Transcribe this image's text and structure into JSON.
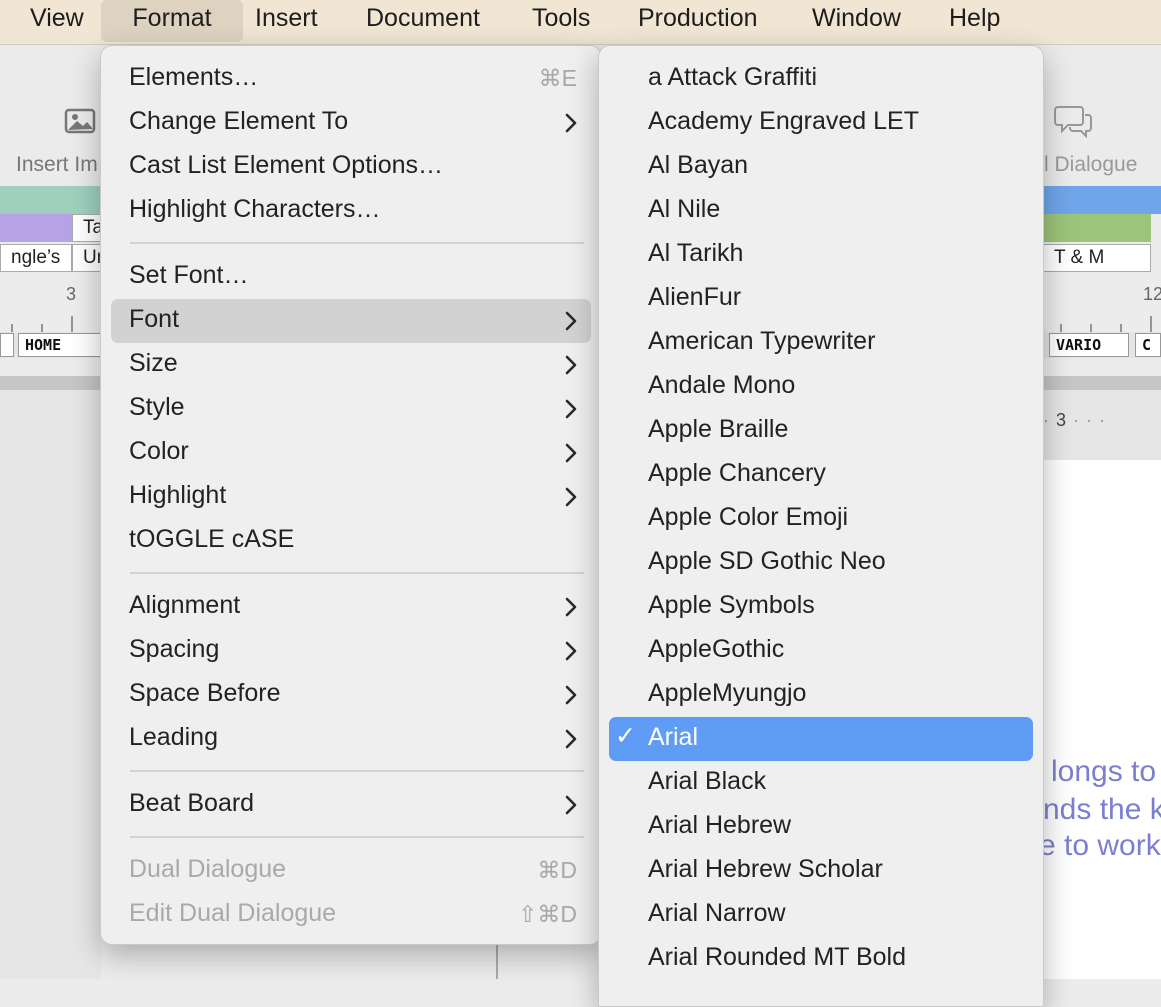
{
  "menubar": {
    "items": [
      {
        "label": "View"
      },
      {
        "label": "Format"
      },
      {
        "label": "Insert"
      },
      {
        "label": "Document"
      },
      {
        "label": "Tools"
      },
      {
        "label": "Production"
      },
      {
        "label": "Window"
      },
      {
        "label": "Help"
      }
    ]
  },
  "toolbar": {
    "insert_image_label": "Insert Im",
    "dual_dialogue_label": "l Dialogue"
  },
  "cards": {
    "left_tab": "Ta",
    "left_row_a": "ngle’s",
    "left_row_b": "Ur",
    "right_row": "T & M"
  },
  "ruler": {
    "left_number": "3",
    "right_number": "12",
    "doc_ruler_number": "3"
  },
  "scenes": {
    "home": "HOME",
    "vario": "VARIO",
    "c": "C"
  },
  "page_text": {
    "line1": "longs to",
    "line2": "nds the k",
    "line3": "e to work"
  },
  "format_menu": {
    "groups": [
      [
        {
          "label": "Elements…",
          "shortcut": "⌘E"
        },
        {
          "label": "Change Element To",
          "submenu": true
        },
        {
          "label": "Cast List Element Options…"
        },
        {
          "label": "Highlight Characters…"
        }
      ],
      [
        {
          "label": "Set Font…"
        },
        {
          "label": "Font",
          "submenu": true,
          "highlighted": true
        },
        {
          "label": "Size",
          "submenu": true
        },
        {
          "label": "Style",
          "submenu": true
        },
        {
          "label": "Color",
          "submenu": true
        },
        {
          "label": "Highlight",
          "submenu": true
        },
        {
          "label": "tOGGLE cASE"
        }
      ],
      [
        {
          "label": "Alignment",
          "submenu": true
        },
        {
          "label": "Spacing",
          "submenu": true
        },
        {
          "label": "Space Before",
          "submenu": true
        },
        {
          "label": "Leading",
          "submenu": true
        }
      ],
      [
        {
          "label": "Beat Board",
          "submenu": true
        }
      ],
      [
        {
          "label": "Dual Dialogue",
          "shortcut": "⌘D",
          "disabled": true
        },
        {
          "label": "Edit Dual Dialogue",
          "shortcut": "⇧⌘D",
          "disabled": true
        }
      ]
    ]
  },
  "font_menu": {
    "check_mark": "✓",
    "items": [
      {
        "label": "a Attack Graffiti"
      },
      {
        "label": "Academy Engraved LET"
      },
      {
        "label": "Al Bayan"
      },
      {
        "label": "Al Nile"
      },
      {
        "label": "Al Tarikh"
      },
      {
        "label": "AlienFur"
      },
      {
        "label": "American Typewriter"
      },
      {
        "label": "Andale Mono"
      },
      {
        "label": "Apple Braille"
      },
      {
        "label": "Apple Chancery"
      },
      {
        "label": "Apple Color Emoji"
      },
      {
        "label": "Apple SD Gothic Neo"
      },
      {
        "label": "Apple Symbols"
      },
      {
        "label": "AppleGothic"
      },
      {
        "label": "AppleMyungjo"
      },
      {
        "label": "Arial",
        "selected": true
      },
      {
        "label": "Arial Black"
      },
      {
        "label": "Arial Hebrew"
      },
      {
        "label": "Arial Hebrew Scholar"
      },
      {
        "label": "Arial Narrow"
      },
      {
        "label": "Arial Rounded MT Bold"
      }
    ]
  },
  "colors": {
    "menubar_bg": "#f1e6d3",
    "menu_selection": "#5e9cf6",
    "menu_highlight": "#d2d2d2",
    "page_text": "#7b7fd0"
  }
}
